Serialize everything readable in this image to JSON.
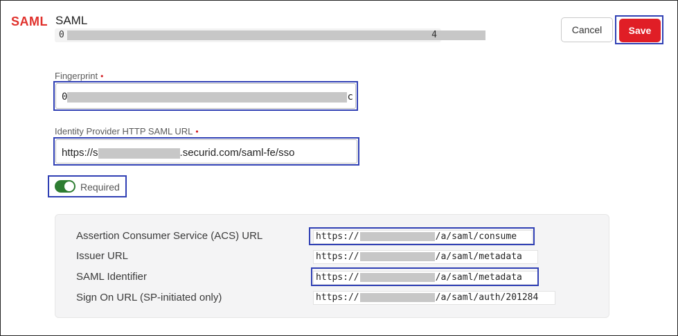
{
  "header": {
    "logo": "SAML",
    "title": "SAML",
    "id_prefix": "0",
    "id_suffix": "4",
    "cancel_label": "Cancel",
    "save_label": "Save"
  },
  "fingerprint": {
    "label": "Fingerprint",
    "required_mark": "•",
    "value_prefix": "0",
    "value_suffix": "c"
  },
  "idp_url": {
    "label": "Identity Provider HTTP SAML URL",
    "required_mark": "•",
    "value_prefix": "https://s",
    "value_suffix": ".securid.com/saml-fe/sso"
  },
  "required_toggle": {
    "label": "Required",
    "on": true
  },
  "sp_info": {
    "rows": [
      {
        "label": "Assertion Consumer Service (ACS) URL",
        "url_prefix": "https://",
        "url_suffix": "/a/saml/consume"
      },
      {
        "label": "Issuer URL",
        "url_prefix": "https://",
        "url_suffix": "/a/saml/metadata"
      },
      {
        "label": "SAML Identifier",
        "url_prefix": "https://",
        "url_suffix": "/a/saml/metadata"
      },
      {
        "label": "Sign On URL (SP-initiated only)",
        "url_prefix": "https://",
        "url_suffix": "/a/saml/auth/201284"
      }
    ]
  },
  "colors": {
    "brand_red": "#e0302b",
    "save_bg": "#e01e26",
    "toggle_on": "#2e7d32",
    "highlight_box": "#2f3fb4"
  }
}
